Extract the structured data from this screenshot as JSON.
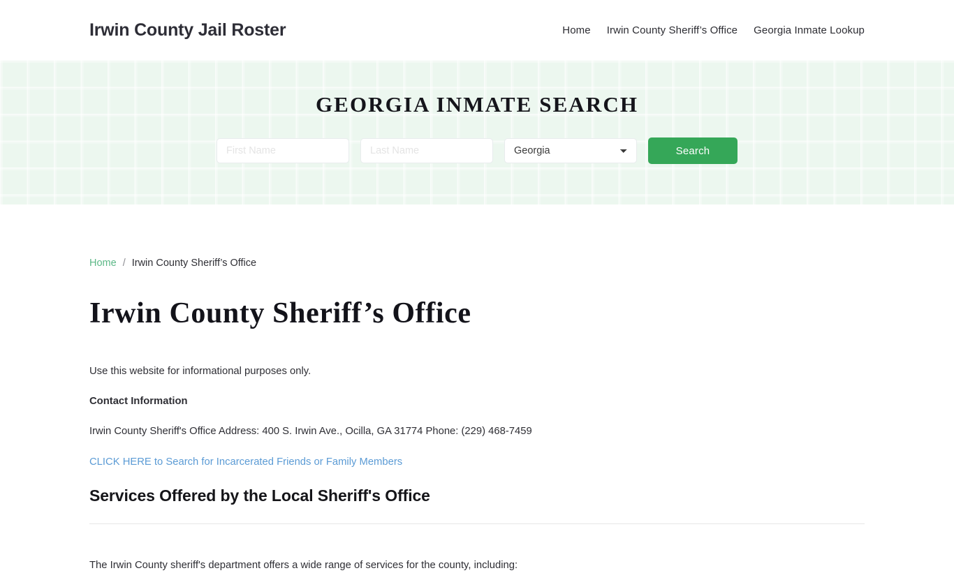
{
  "header": {
    "brand": "Irwin County Jail Roster",
    "nav": [
      {
        "label": "Home"
      },
      {
        "label": "Irwin County Sheriff’s Office"
      },
      {
        "label": "Georgia Inmate Lookup"
      }
    ]
  },
  "hero": {
    "title": "GEORGIA INMATE SEARCH",
    "accent_color": "#35a758",
    "background_color": "#ecf7ef",
    "form": {
      "first_name_placeholder": "First Name",
      "first_name_value": "",
      "last_name_placeholder": "Last Name",
      "last_name_value": "",
      "state_selected": "Georgia",
      "state_options": [
        "Georgia"
      ],
      "submit_label": "Search",
      "dropdown_icon": "chevron-down-icon"
    }
  },
  "breadcrumb": {
    "home": "Home",
    "separator": "/",
    "current": "Irwin County Sheriff’s Office",
    "link_color": "#5cb887"
  },
  "main": {
    "page_title": "Irwin County Sheriff’s Office",
    "intro": "Use this website for informational purposes only.",
    "contact_heading": "Contact Information",
    "contact_details": "Irwin County Sheriff's Office Address: 400 S. Irwin Ave., Ocilla, GA 31774 Phone: (229) 468-7459",
    "cta_link": "CLICK HERE to Search for Incarcerated Friends or Family Members",
    "cta_link_color": "#5b9bd5",
    "services_heading": "Services Offered by the Local Sheriff's Office",
    "services_intro": "The Irwin County sheriff's department offers a wide range of services for the county, including:"
  }
}
